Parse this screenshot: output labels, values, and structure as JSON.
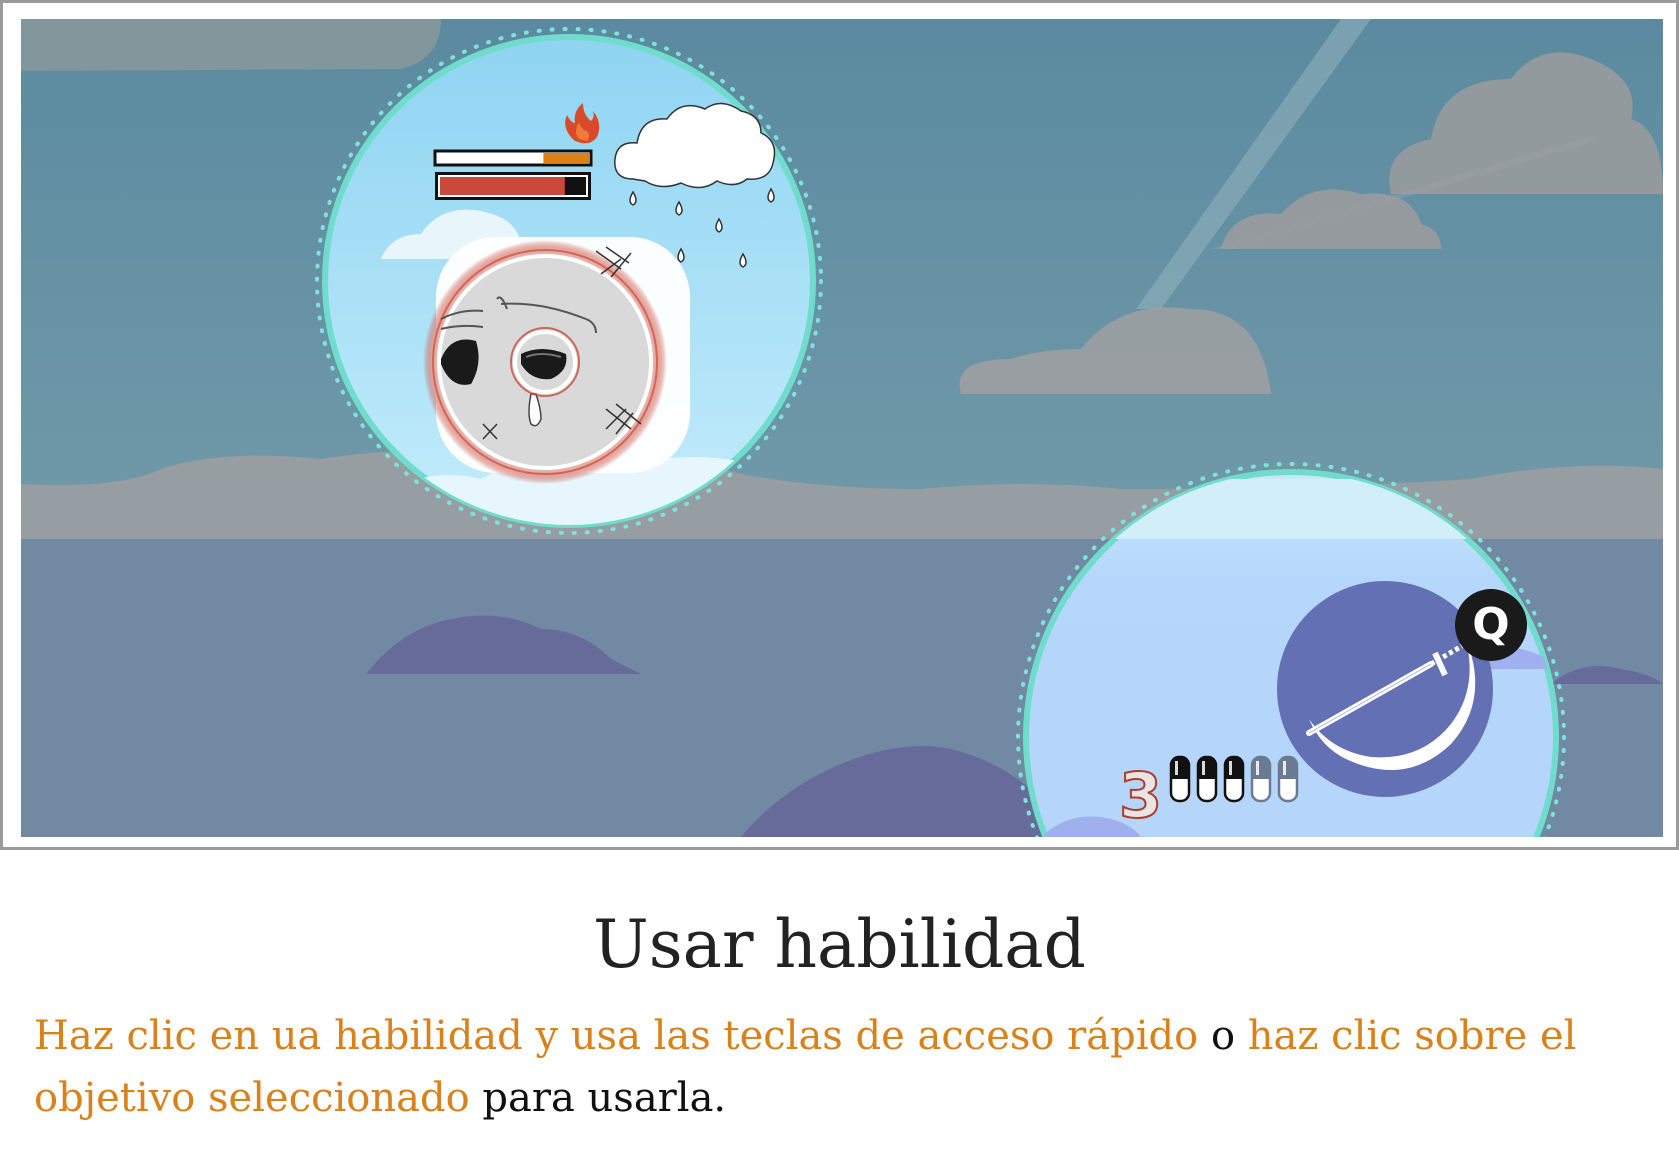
{
  "game": {
    "hotkey": "Q",
    "ammo_count": "3",
    "ammo_total": 5,
    "ammo_loaded": 3,
    "enemy_health_fraction": 0.85,
    "enemy_fire_fraction": 0.3,
    "icons": {
      "fire": "fire-icon",
      "cloud": "rain-cloud-icon",
      "weapon": "scythe-sword-icon"
    }
  },
  "caption": {
    "title": "Usar habilidad",
    "part1": "Haz clic en ua habilidad y usa las teclas de acceso rápido",
    "part2": " o ",
    "part3": "haz clic sobre el objetivo seleccionado",
    "part4": " para usarla."
  },
  "colors": {
    "highlight": "#d9821c",
    "ring": "#7fe3dc",
    "health": "#c94a3a"
  }
}
